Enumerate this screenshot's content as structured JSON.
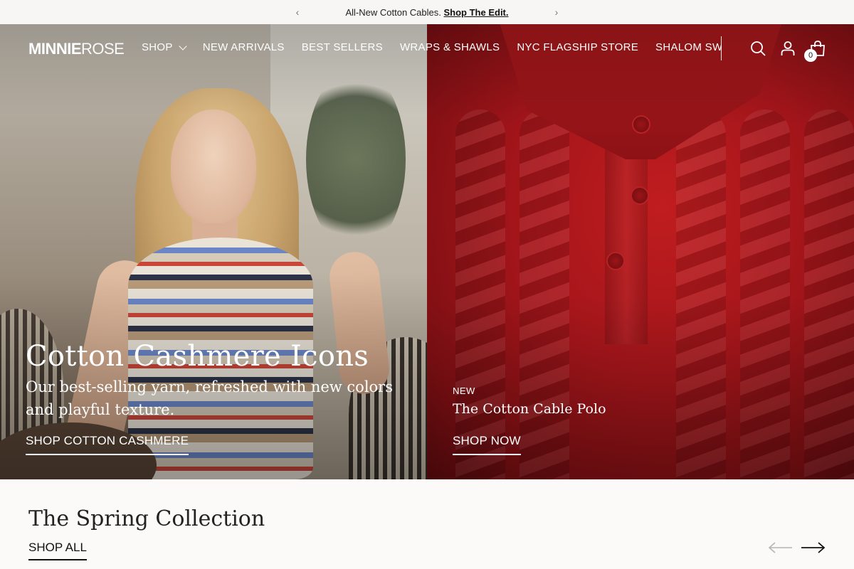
{
  "announcement": {
    "prev_icon": "chevron-left-icon",
    "next_icon": "chevron-right-icon",
    "message": "All-New Cotton Cables.",
    "link": "Shop The Edit."
  },
  "header": {
    "logo_bold": "MINNIE",
    "logo_light": "ROSE",
    "nav": [
      {
        "label": "SHOP",
        "has_dropdown": true
      },
      {
        "label": "NEW ARRIVALS"
      },
      {
        "label": "BEST SELLERS"
      },
      {
        "label": "WRAPS & SHAWLS"
      },
      {
        "label": "NYC FLAGSHIP STORE"
      },
      {
        "label": "SHALOM SWE"
      }
    ],
    "icons": [
      "search-icon",
      "account-icon",
      "cart-icon"
    ],
    "cart_count": "0"
  },
  "hero_left": {
    "title": "Cotton Cashmere Icons",
    "subtitle": "Our best-selling yarn, refreshed with new colors and playful texture.",
    "cta": "SHOP COTTON CASHMERE"
  },
  "hero_right": {
    "eyebrow": "NEW",
    "title": "The Cotton Cable Polo",
    "cta": "SHOP NOW"
  },
  "collection": {
    "title": "The Spring Collection",
    "shop_all": "SHOP ALL",
    "prev_icon": "arrow-left-icon",
    "next_icon": "arrow-right-icon"
  },
  "colors": {
    "accent_red": "#a3151a",
    "text_dark": "#111111",
    "page_bg": "#fbfaf8"
  }
}
